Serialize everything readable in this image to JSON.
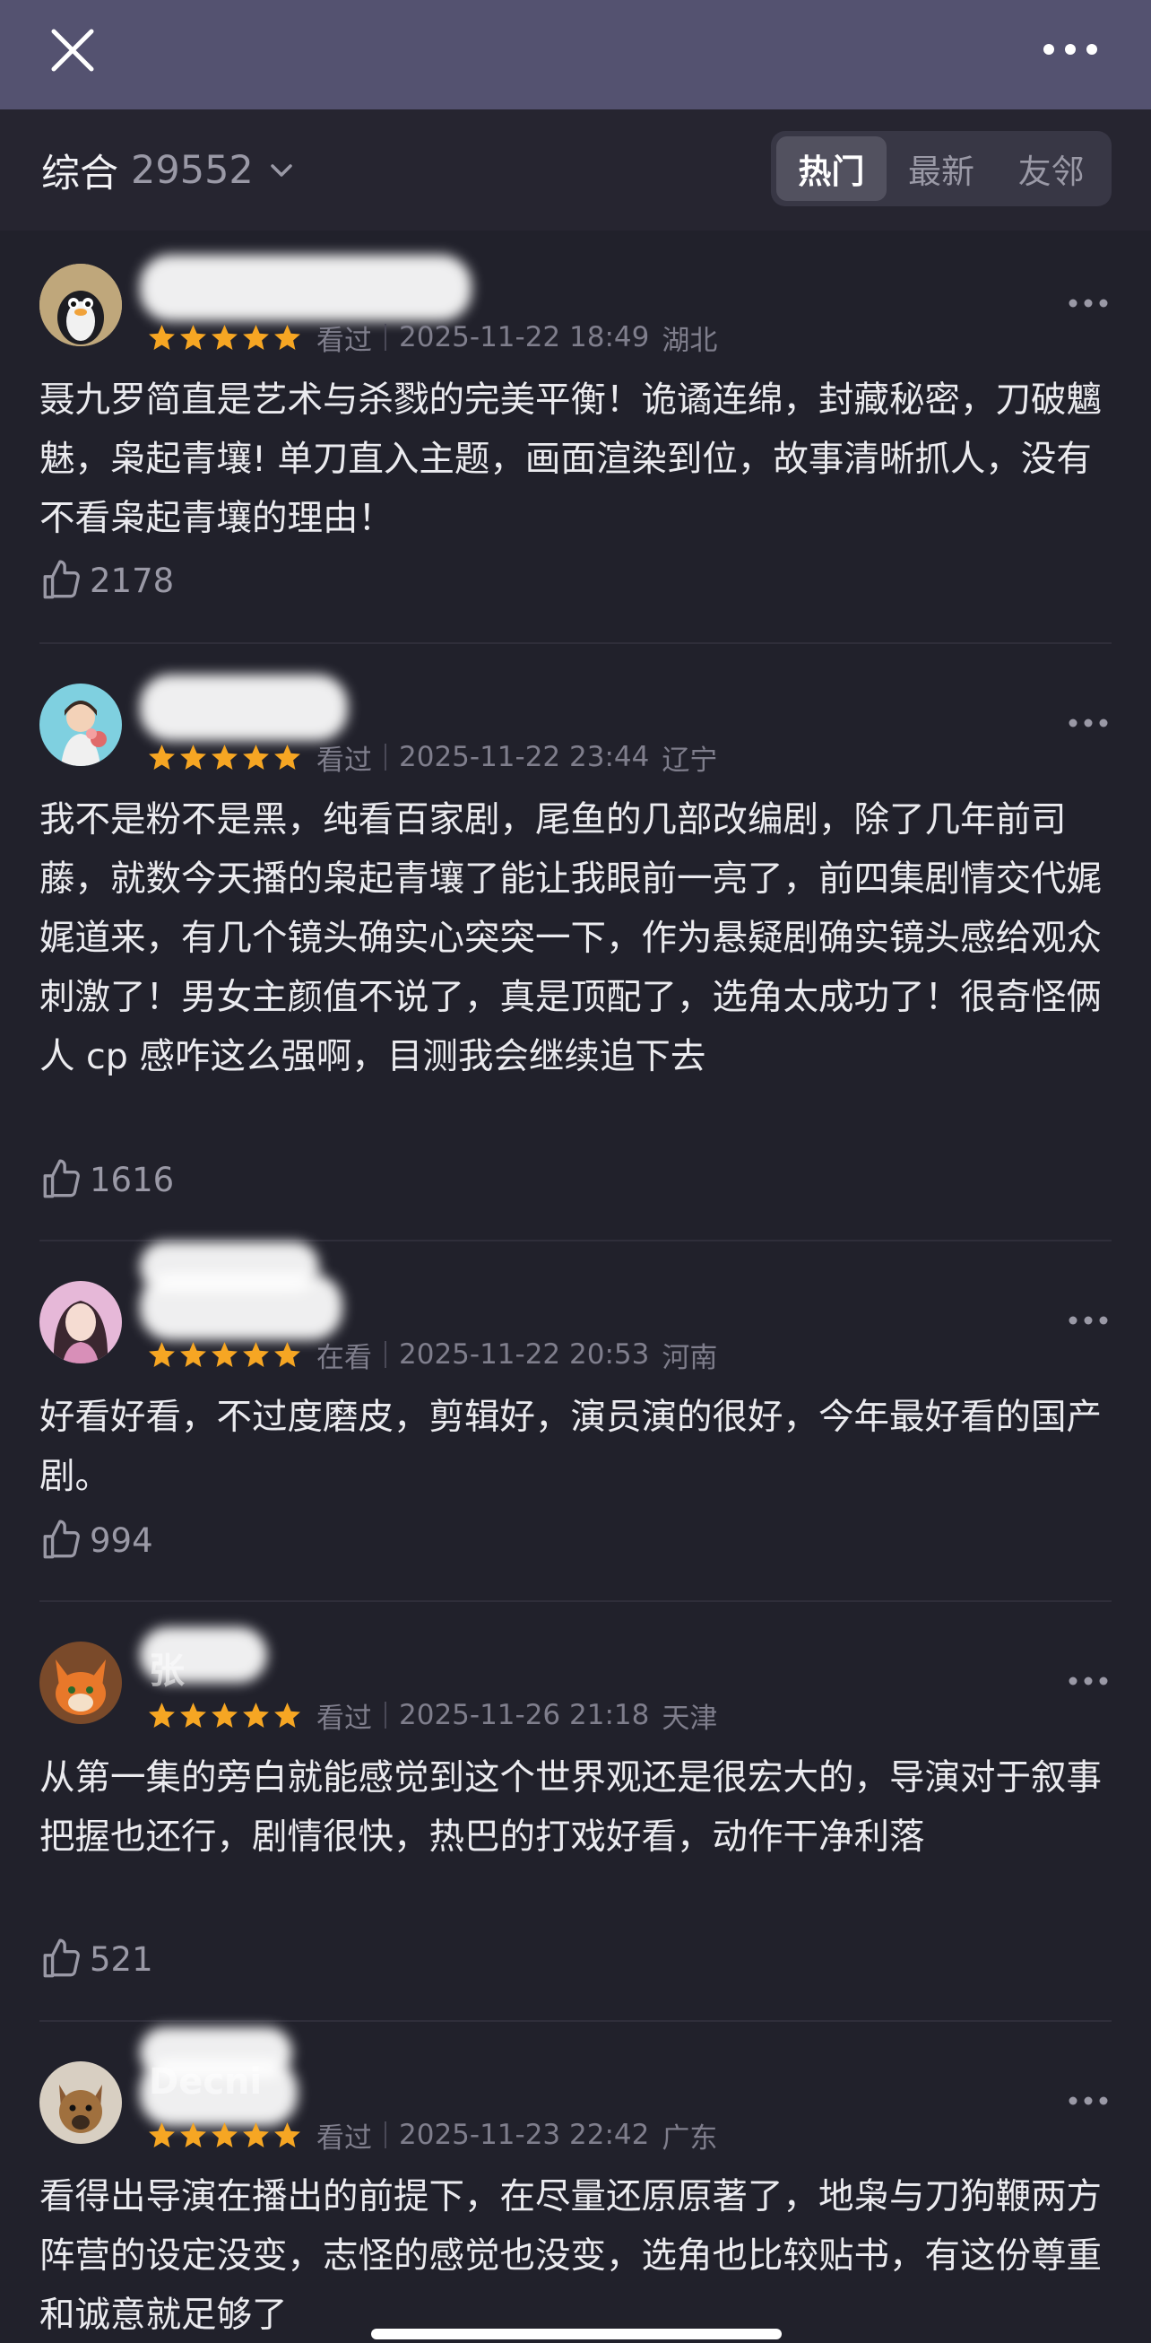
{
  "header": {
    "close_icon": "close-icon",
    "more_icon": "more-horizontal-icon"
  },
  "filter": {
    "label": "综合",
    "count": "29552",
    "tabs": [
      {
        "label": "热门",
        "active": true
      },
      {
        "label": "最新",
        "active": false
      },
      {
        "label": "友邻",
        "active": false
      }
    ]
  },
  "colors": {
    "star": "#f6a623",
    "top_bar": "#545270",
    "background": "#21212b"
  },
  "comments": [
    {
      "user": "",
      "rating": 5,
      "status": "看过",
      "time": "2025-11-22 18:49",
      "region": "湖北",
      "text": "聂九罗简直是艺术与杀戮的完美平衡！诡谲连绵，封藏秘密，刀破魑魅，枭起青壤! 单刀直入主题，画面渲染到位，故事清晰抓人，没有不看枭起青壤的理由！",
      "likes": "2178"
    },
    {
      "user": "",
      "rating": 5,
      "status": "看过",
      "time": "2025-11-22 23:44",
      "region": "辽宁",
      "text": "我不是粉不是黑，纯看百家剧，尾鱼的几部改编剧，除了几年前司藤，就数今天播的枭起青壤了能让我眼前一亮了，前四集剧情交代娓娓道来，有几个镜头确实心突突一下，作为悬疑剧确实镜头感给观众刺激了！男女主颜值不说了，真是顶配了，选角太成功了！很奇怪俩人 cp 感咋这么强啊，目测我会继续追下去",
      "likes": "1616"
    },
    {
      "user": "",
      "rating": 5,
      "status": "在看",
      "time": "2025-11-22 20:53",
      "region": "河南",
      "text": "好看好看，不过度磨皮，剪辑好，演员演的很好，今年最好看的国产剧。",
      "likes": "994"
    },
    {
      "user": "张",
      "rating": 5,
      "status": "看过",
      "time": "2025-11-26 21:18",
      "region": "天津",
      "text": "从第一集的旁白就能感觉到这个世界观还是很宏大的，导演对于叙事把握也还行，剧情很快，热巴的打戏好看，动作干净利落",
      "likes": "521"
    },
    {
      "user": "Decni",
      "rating": 5,
      "status": "看过",
      "time": "2025-11-23 22:42",
      "region": "广东",
      "text": "看得出导演在播出的前提下，在尽量还原原著了，地枭与刀狗鞭两方阵营的设定没变，志怪的感觉也没变，选角也比较贴书，有这份尊重和诚意就足够了",
      "likes": ""
    }
  ]
}
